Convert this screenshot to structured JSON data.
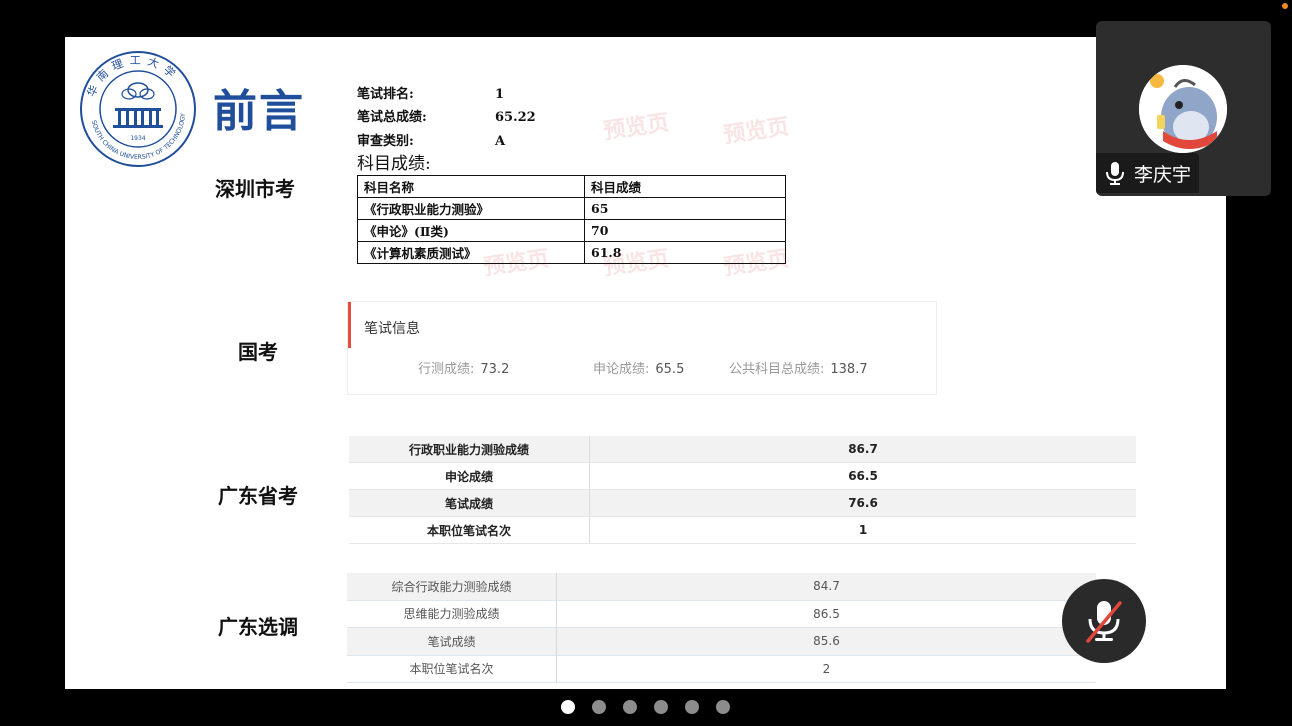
{
  "slide": {
    "title": "前言",
    "logo": {
      "icon": "scut-university-seal-icon",
      "top_text": "华南理工大学",
      "bottom_text": "SOUTH CHINA UNIVERSITY OF TECHNOLOGY",
      "year": "1934"
    },
    "sections": {
      "shenzhen": "深圳市考",
      "national": "国考",
      "guangdong_province": "广东省考",
      "guangdong_selection": "广东选调"
    },
    "shenzhen": {
      "rank_label": "笔试排名:",
      "rank_value": "1",
      "total_label": "笔试总成绩:",
      "total_value": "65.22",
      "review_label": "审查类别:",
      "review_value": "A",
      "subjects_heading": "科目成绩:",
      "watermark": "预览页",
      "table_headers": [
        "科目名称",
        "科目成绩"
      ],
      "rows": [
        [
          "《行政职业能力测验》",
          "65"
        ],
        [
          "《申论》(Ⅱ类)",
          "70"
        ],
        [
          "《计算机素质测试》",
          "61.8"
        ]
      ]
    },
    "national": {
      "card_title": "笔试信息",
      "items": [
        {
          "label": "行测成绩:",
          "value": "73.2"
        },
        {
          "label": "申论成绩:",
          "value": "65.5"
        },
        {
          "label": "公共科目总成绩:",
          "value": "138.7"
        }
      ]
    },
    "guangdong_province": {
      "rows": [
        [
          "行政职业能力测验成绩",
          "86.7"
        ],
        [
          "申论成绩",
          "66.5"
        ],
        [
          "笔试成绩",
          "76.6"
        ],
        [
          "本职位笔试名次",
          "1"
        ]
      ]
    },
    "guangdong_selection": {
      "rows": [
        [
          "综合行政能力测验成绩",
          "84.7"
        ],
        [
          "思维能力测验成绩",
          "86.5"
        ],
        [
          "笔试成绩",
          "85.6"
        ],
        [
          "本职位笔试名次",
          "2"
        ]
      ]
    }
  },
  "video": {
    "participant_name": "李庆宇",
    "avatar_icon": "cartoon-fish-avatar-icon",
    "mic_icon": "microphone-icon"
  },
  "controls": {
    "mute_icon": "microphone-muted-icon",
    "page_count": 6,
    "active_page": 1
  },
  "colors": {
    "title_blue": "#1f4e9b",
    "accent_red": "#e84c3d",
    "notify_orange": "#f08a24"
  }
}
